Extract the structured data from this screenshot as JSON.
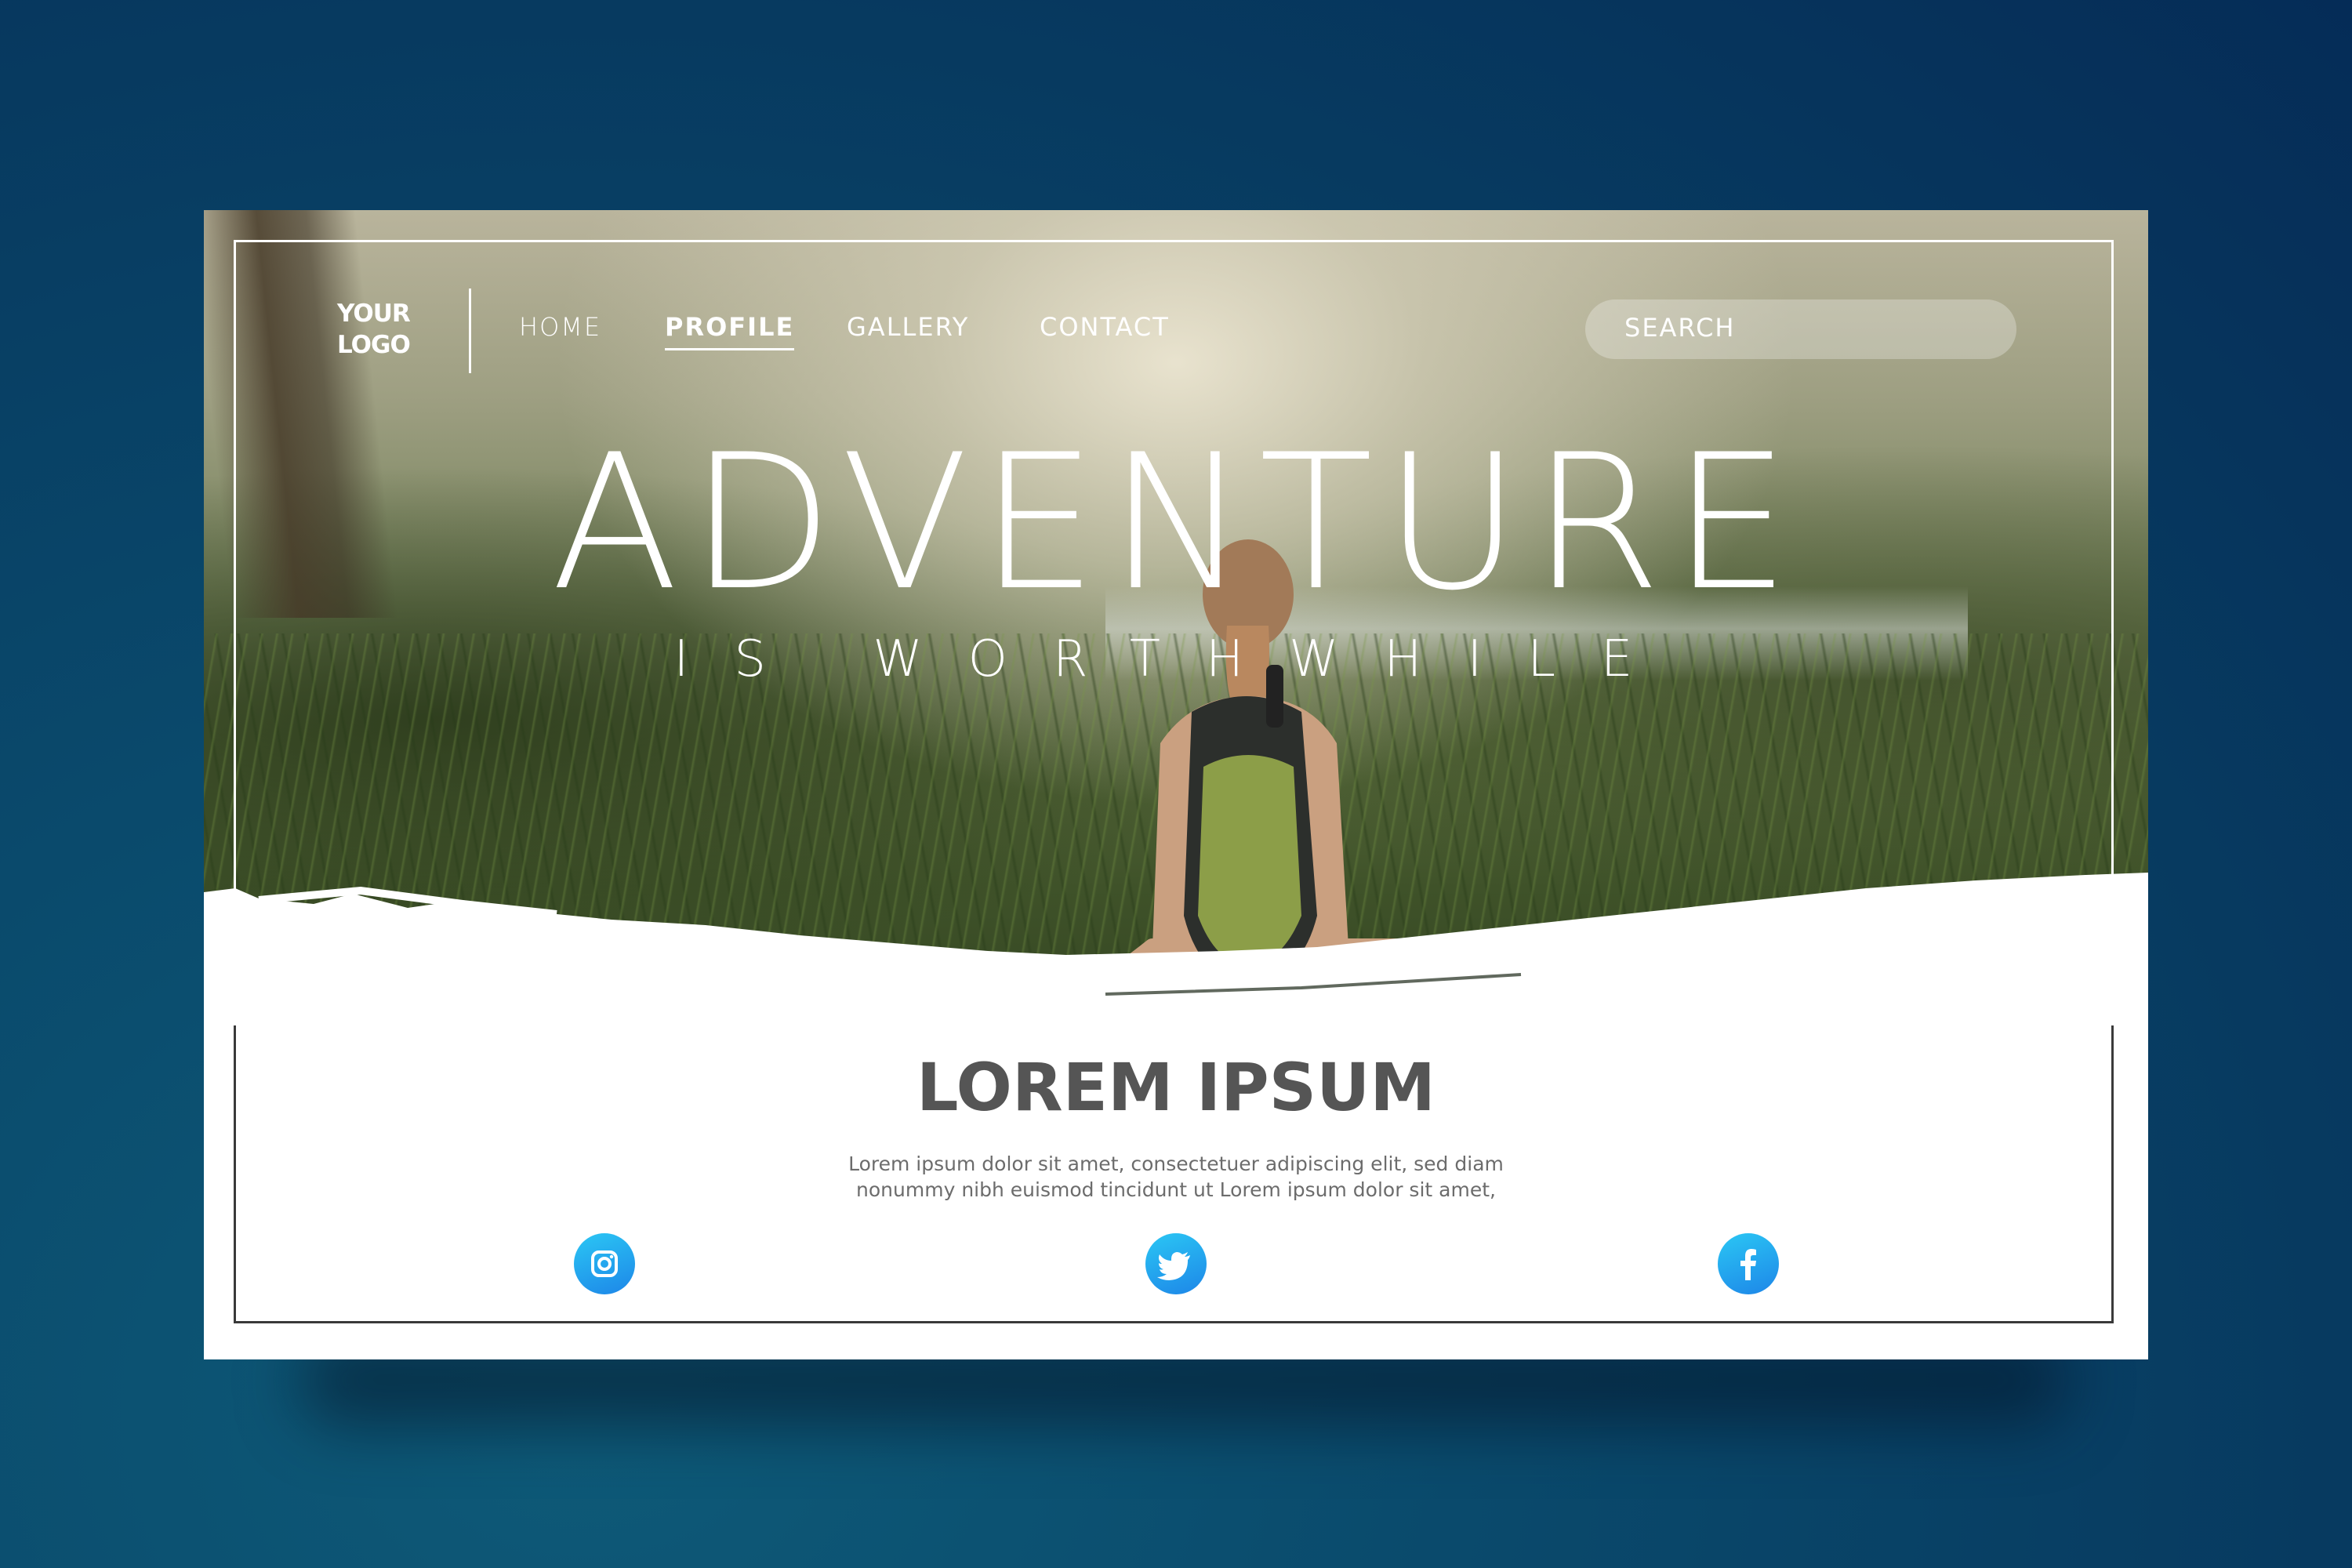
{
  "logo": {
    "line1": "YOUR",
    "line2": "LOGO"
  },
  "nav": {
    "items": [
      {
        "label": "HOME"
      },
      {
        "label": "PROFILE",
        "active": true
      },
      {
        "label": "GALLERY"
      },
      {
        "label": "CONTACT"
      }
    ]
  },
  "search": {
    "label": "SEARCH"
  },
  "hero": {
    "title": "ADVENTURE",
    "subtitle": "IS WORTHWHILE"
  },
  "content": {
    "title": "LOREM IPSUM",
    "body_line1": "Lorem ipsum dolor sit amet, consectetuer adipiscing elit, sed diam",
    "body_line2": "nonummy nibh euismod tincidunt ut Lorem ipsum dolor sit amet,"
  },
  "social": [
    {
      "icon": "instagram-icon"
    },
    {
      "icon": "twitter-icon"
    },
    {
      "icon": "facebook-icon"
    }
  ],
  "colors": {
    "background": "#073a60",
    "social_gradient_start": "#2bc7f4",
    "social_gradient_end": "#1d86e8",
    "heading_gray": "#555555"
  }
}
